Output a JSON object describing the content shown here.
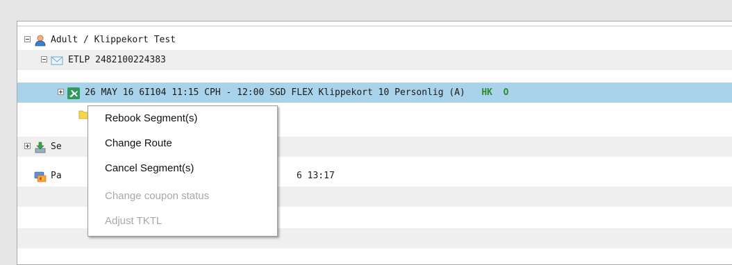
{
  "tree": {
    "passenger": "Adult / Klippekort Test",
    "ticket": "ETLP 2482100224383",
    "segment": {
      "text": "26 MAY 16  6I104   11:15 CPH - 12:00 SGD  FLEX Klippekort 10 Personlig (A)",
      "status": "HK",
      "coupon": "O"
    },
    "services_label": "Se",
    "payment_label": "Pa",
    "payment_date": "6  13:17"
  },
  "context_menu": {
    "items": [
      {
        "label": "Rebook Segment(s)",
        "enabled": true
      },
      {
        "label": "Change Route",
        "enabled": true
      },
      {
        "label": "Cancel Segment(s)",
        "enabled": true
      },
      {
        "label": "Change coupon status",
        "enabled": false
      },
      {
        "label": "Adjust TKTL",
        "enabled": false
      }
    ]
  },
  "colors": {
    "selected_row": "#a9d3ea",
    "status_green": "#2e8b2e",
    "disabled_text": "#a8a8a8"
  },
  "icons": [
    "person-icon",
    "envelope-icon",
    "airplane-icon",
    "folder-icon",
    "download-icon",
    "credit-card-icon"
  ]
}
